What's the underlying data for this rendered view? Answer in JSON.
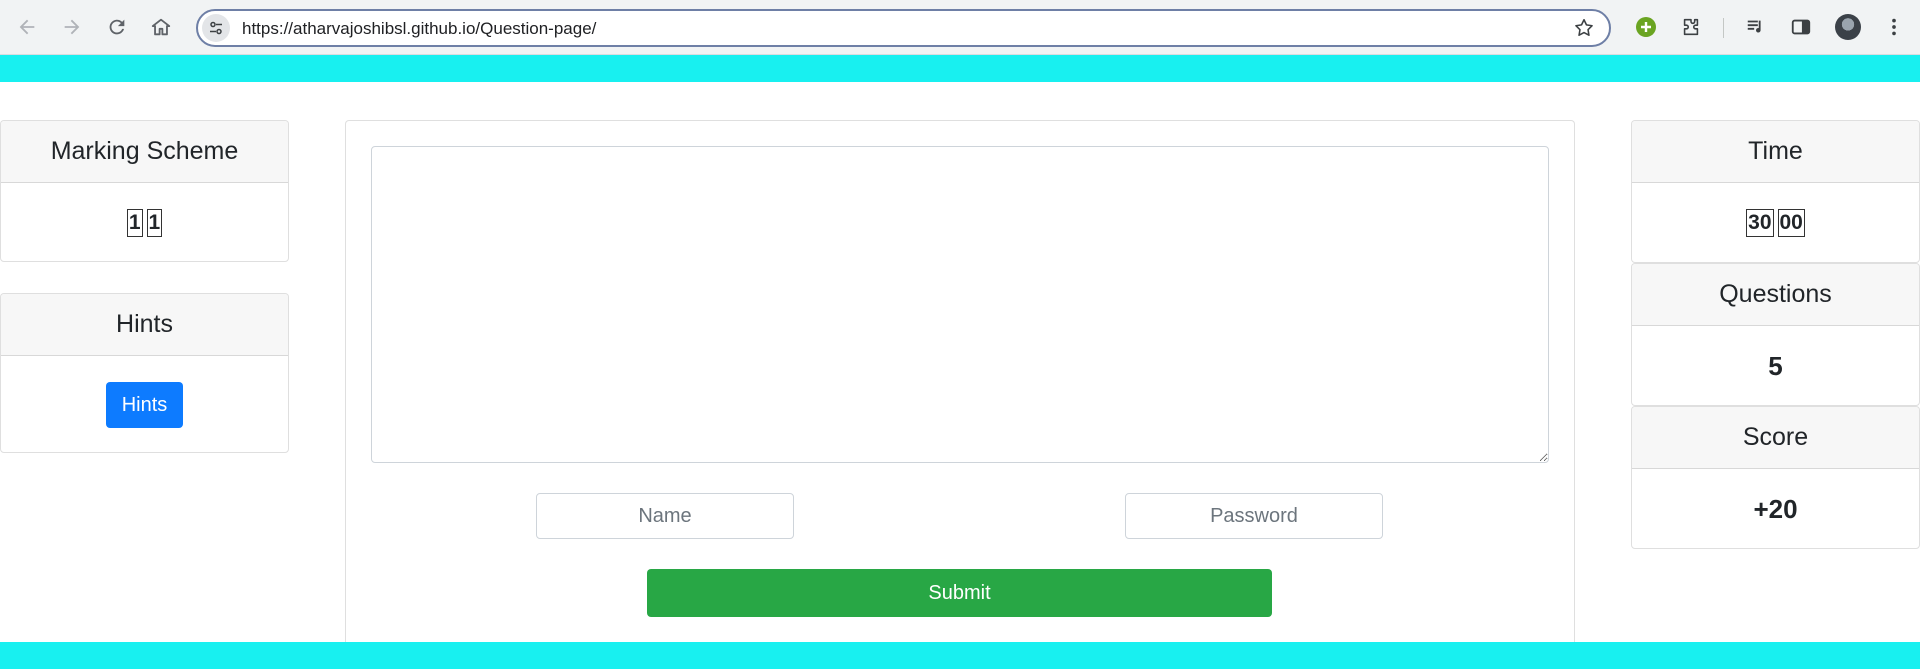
{
  "browser": {
    "url": "https://atharvajoshibsl.github.io/Question-page/"
  },
  "marking_scheme": {
    "title": "Marking Scheme",
    "values": [
      "1",
      "1"
    ]
  },
  "hints": {
    "title": "Hints",
    "button_label": "Hints"
  },
  "form": {
    "answer_value": "",
    "name_placeholder": "Name",
    "password_placeholder": "Password",
    "submit_label": "Submit"
  },
  "time": {
    "title": "Time",
    "minutes": "30",
    "seconds": "00"
  },
  "questions": {
    "title": "Questions",
    "value": "5"
  },
  "score": {
    "title": "Score",
    "value": "+20"
  },
  "colors": {
    "accent_band": "#18f0f0",
    "hints_button": "#0d7bff",
    "submit_button": "#28a745"
  }
}
